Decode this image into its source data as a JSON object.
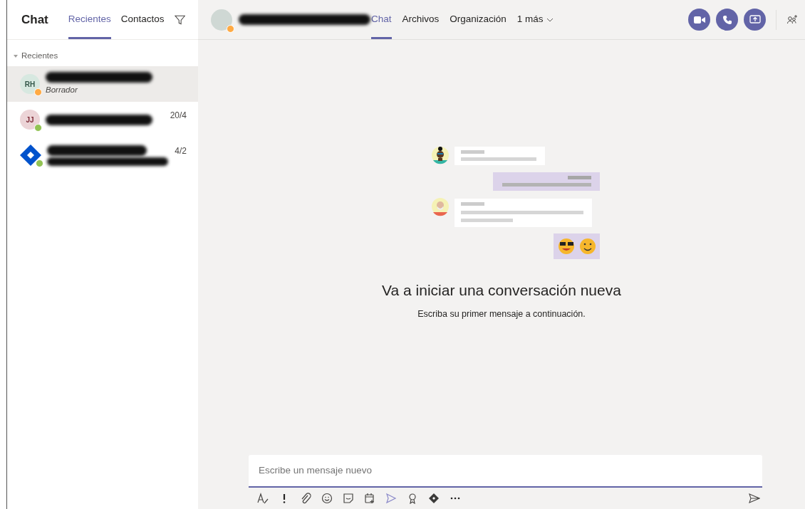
{
  "sidebar": {
    "title": "Chat",
    "tabs": [
      {
        "label": "Recientes",
        "selected": true
      },
      {
        "label": "Contactos",
        "selected": false
      }
    ],
    "section": {
      "label": "Recientes",
      "expanded": true
    },
    "chats": [
      {
        "initials": "RH",
        "kind": "person",
        "color": "#ffaa44",
        "subtitle": "Borrador",
        "selected": true
      },
      {
        "initials": "JJ",
        "kind": "person",
        "color": "#92c353",
        "date": "20/4",
        "selected": false
      },
      {
        "kind": "bot",
        "color": "#92c353",
        "date": "4/2",
        "selected": false
      }
    ]
  },
  "header": {
    "color": "#ffaa44",
    "tabs": [
      {
        "label": "Chat",
        "selected": true
      },
      {
        "label": "Archivos",
        "selected": false
      },
      {
        "label": "Organización",
        "selected": false
      },
      {
        "label": "1 más",
        "selected": false
      }
    ]
  },
  "empty_state": {
    "title": "Va a iniciar una conversación nueva",
    "subtitle": "Escriba su primer mensaje a continuación."
  },
  "composer": {
    "placeholder": "Escribe un mensaje nuevo"
  }
}
